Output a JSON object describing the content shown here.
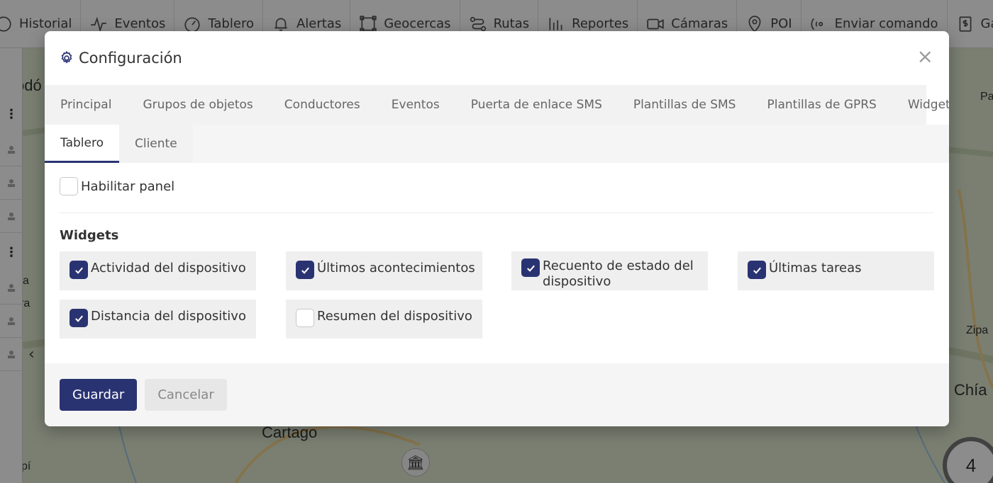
{
  "topnav": {
    "items": [
      {
        "label": "Historial",
        "icon": "history-icon"
      },
      {
        "label": "Eventos",
        "icon": "pulse-icon"
      },
      {
        "label": "Tablero",
        "icon": "gauge-icon"
      },
      {
        "label": "Alertas",
        "icon": "bell-icon"
      },
      {
        "label": "Geocercas",
        "icon": "geofence-icon"
      },
      {
        "label": "Rutas",
        "icon": "route-icon"
      },
      {
        "label": "Reportes",
        "icon": "bar-chart-icon"
      },
      {
        "label": "Cámaras",
        "icon": "camera-icon"
      },
      {
        "label": "POI",
        "icon": "map-pin-icon"
      },
      {
        "label": "Enviar comando",
        "icon": "satellite-icon"
      },
      {
        "label": "Gastos",
        "icon": "invoice-icon"
      }
    ]
  },
  "map": {
    "labels": {
      "top_left": "odó",
      "right_p": "Pa",
      "left_a": "a",
      "left_ra": "ra",
      "zipa": "Zipa",
      "chia": "Chía",
      "cartago": "Cartago",
      "bottom_left": "pí"
    },
    "cluster_count": "4"
  },
  "modal": {
    "title": "Configuración",
    "title_icon": "gear-icon",
    "close": "×",
    "tabs": [
      "Principal",
      "Grupos de objetos",
      "Conductores",
      "Eventos",
      "Puerta de enlace SMS",
      "Plantillas de SMS",
      "Plantillas de GPRS",
      "Widgets"
    ],
    "subtabs": [
      "Tablero",
      "Cliente"
    ],
    "active_subtab": "Tablero",
    "enable_panel": {
      "label": "Habilitar panel",
      "checked": false
    },
    "widgets_title": "Widgets",
    "widgets": [
      {
        "label": "Actividad del dispositivo",
        "checked": true
      },
      {
        "label": "Últimos acontecimientos",
        "checked": true
      },
      {
        "label": "Recuento de estado del dispositivo",
        "checked": true
      },
      {
        "label": "Últimas tareas",
        "checked": true
      },
      {
        "label": "Distancia del dispositivo",
        "checked": true
      },
      {
        "label": "Resumen del dispositivo",
        "checked": false
      }
    ],
    "buttons": {
      "save": "Guardar",
      "cancel": "Cancelar"
    }
  },
  "colors": {
    "primary": "#2a3372",
    "tab_bg": "#f2f2f2",
    "widget_bg": "#efefef",
    "map_bg": "#dfe8d0"
  }
}
